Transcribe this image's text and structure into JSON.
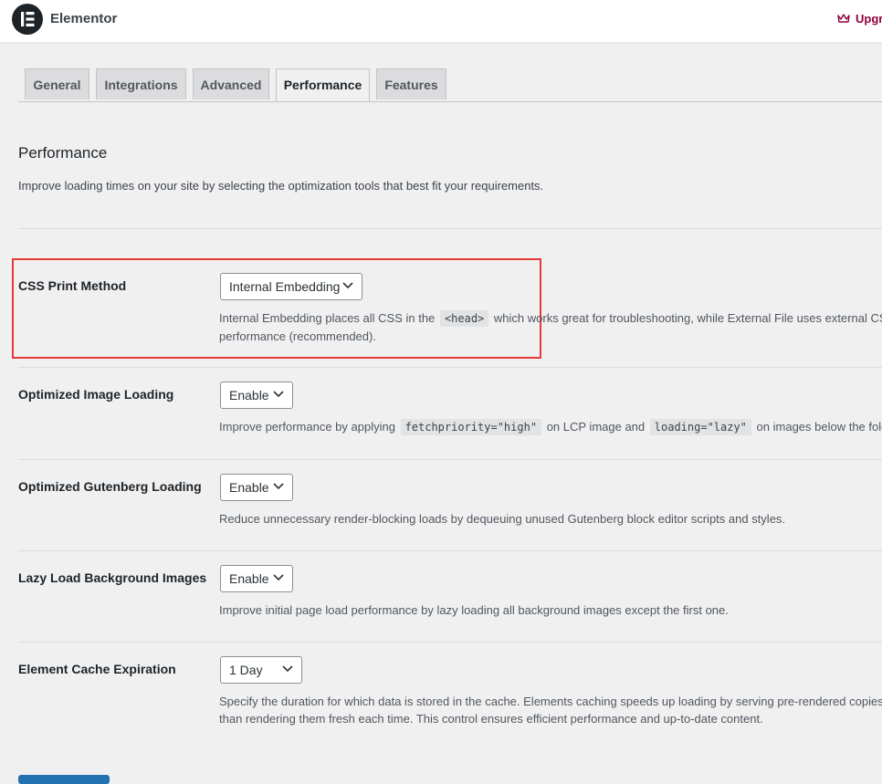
{
  "header": {
    "brand": "Elementor",
    "upgrade_label": "Upgr"
  },
  "tabs": [
    {
      "label": "General"
    },
    {
      "label": "Integrations"
    },
    {
      "label": "Advanced"
    },
    {
      "label": "Performance",
      "active": true
    },
    {
      "label": "Features"
    }
  ],
  "section": {
    "title": "Performance",
    "description": "Improve loading times on your site by selecting the optimization tools that best fit your requirements."
  },
  "settings": {
    "css_print": {
      "label": "CSS Print Method",
      "value": "Internal Embedding",
      "desc_before": "Internal Embedding places all CSS in the",
      "desc_code": "<head>",
      "desc_after": "which works great for troubleshooting, while External File uses external CSS file",
      "desc_line2": "performance (recommended)."
    },
    "image_loading": {
      "label": "Optimized Image Loading",
      "value": "Enable",
      "desc_before": "Improve performance by applying",
      "desc_code1": "fetchpriority=\"high\"",
      "desc_mid": "on LCP image and",
      "desc_code2": "loading=\"lazy\"",
      "desc_after": "on images below the fold."
    },
    "gutenberg": {
      "label": "Optimized Gutenberg Loading",
      "value": "Enable",
      "desc": "Reduce unnecessary render-blocking loads by dequeuing unused Gutenberg block editor scripts and styles."
    },
    "lazy_bg": {
      "label": "Lazy Load Background Images",
      "value": "Enable",
      "desc": "Improve initial page load performance by lazy loading all background images except the first one."
    },
    "cache_expiration": {
      "label": "Element Cache Expiration",
      "value": "1 Day",
      "desc_line1": "Specify the duration for which data is stored in the cache. Elements caching speeds up loading by serving pre-rendered copies of e",
      "desc_line2": "than rendering them fresh each time. This control ensures efficient performance and up-to-date content."
    }
  },
  "colors": {
    "accent": "#92003b",
    "highlight_border": "#e53935",
    "primary_button": "#2271b1"
  }
}
